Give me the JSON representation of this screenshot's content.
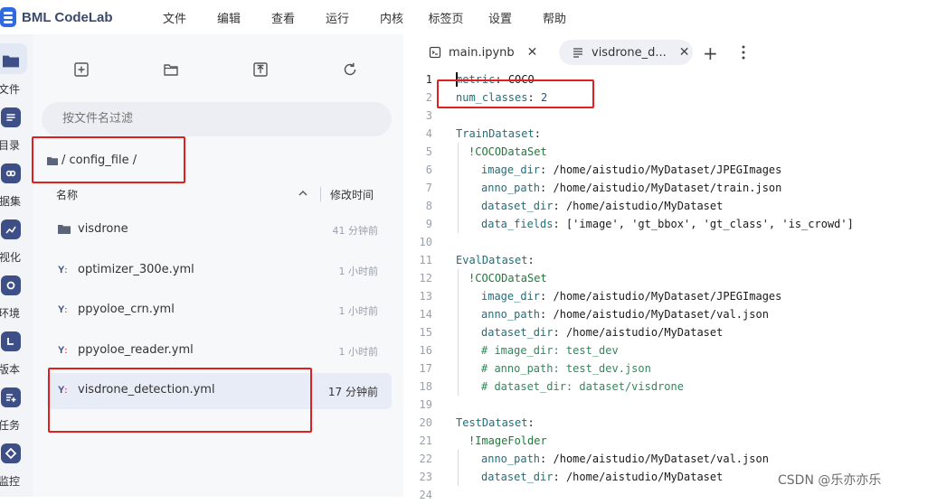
{
  "app": {
    "name": "BML CodeLab",
    "menu": [
      "文件",
      "编辑",
      "查看",
      "运行",
      "内核",
      "标签页",
      "设置",
      "帮助"
    ]
  },
  "rail": [
    {
      "label": "文件",
      "icon": "folder-icon"
    },
    {
      "label": "目录",
      "icon": "list-icon"
    },
    {
      "label": "数据集",
      "icon": "dataset-link-icon"
    },
    {
      "label": "可视化",
      "icon": "chart-icon"
    },
    {
      "label": "环境",
      "icon": "environment-icon"
    },
    {
      "label": "版本",
      "icon": "version-icon"
    },
    {
      "label": "任务",
      "icon": "task-add-icon"
    },
    {
      "label": "监控",
      "icon": "monitor-icon"
    }
  ],
  "filebrowser": {
    "filter_placeholder": "按文件名过滤",
    "breadcrumb": "/ config_file /",
    "col_name": "名称",
    "col_time": "修改时间",
    "files": [
      {
        "name": "visdrone",
        "time": "41 分钟前",
        "type": "folder",
        "selected": false
      },
      {
        "name": "optimizer_300e.yml",
        "time": "1 小时前",
        "type": "yaml",
        "selected": false
      },
      {
        "name": "ppyoloe_crn.yml",
        "time": "1 小时前",
        "type": "yaml",
        "selected": false
      },
      {
        "name": "ppyoloe_reader.yml",
        "time": "1 小时前",
        "type": "yaml",
        "selected": false
      },
      {
        "name": "visdrone_detection.yml",
        "time": "17 分钟前",
        "type": "yaml",
        "selected": true
      }
    ]
  },
  "editor": {
    "tabs": [
      {
        "label": "main.ipynb",
        "active": false
      },
      {
        "label": "visdrone_d...",
        "active": true
      }
    ],
    "lines": [
      {
        "n": "1",
        "indent": 0,
        "key": "metric",
        "value": "COCO"
      },
      {
        "n": "2",
        "indent": 0,
        "key": "num_classes",
        "value": "2"
      },
      {
        "n": "3",
        "indent": 0,
        "blank": true
      },
      {
        "n": "4",
        "indent": 0,
        "key": "TrainDataset",
        "value": ""
      },
      {
        "n": "5",
        "indent": 1,
        "tag": "!COCODataSet"
      },
      {
        "n": "6",
        "indent": 2,
        "key": "image_dir",
        "value": "/home/aistudio/MyDataset/JPEGImages"
      },
      {
        "n": "7",
        "indent": 2,
        "key": "anno_path",
        "value": "/home/aistudio/MyDataset/train.json"
      },
      {
        "n": "8",
        "indent": 2,
        "key": "dataset_dir",
        "value": "/home/aistudio/MyDataset"
      },
      {
        "n": "9",
        "indent": 2,
        "key": "data_fields",
        "value": "['image', 'gt_bbox', 'gt_class', 'is_crowd']"
      },
      {
        "n": "10",
        "indent": 0,
        "blank": true
      },
      {
        "n": "11",
        "indent": 0,
        "key": "EvalDataset",
        "value": ""
      },
      {
        "n": "12",
        "indent": 1,
        "tag": "!COCODataSet"
      },
      {
        "n": "13",
        "indent": 2,
        "key": "image_dir",
        "value": "/home/aistudio/MyDataset/JPEGImages"
      },
      {
        "n": "14",
        "indent": 2,
        "key": "anno_path",
        "value": "/home/aistudio/MyDataset/val.json"
      },
      {
        "n": "15",
        "indent": 2,
        "key": "dataset_dir",
        "value": "/home/aistudio/MyDataset"
      },
      {
        "n": "16",
        "indent": 2,
        "comment": "# image_dir: test_dev"
      },
      {
        "n": "17",
        "indent": 2,
        "comment": "# anno_path: test_dev.json"
      },
      {
        "n": "18",
        "indent": 2,
        "comment": "# dataset_dir: dataset/visdrone"
      },
      {
        "n": "19",
        "indent": 0,
        "blank": true
      },
      {
        "n": "20",
        "indent": 0,
        "key": "TestDataset",
        "value": ""
      },
      {
        "n": "21",
        "indent": 1,
        "tag": "!ImageFolder"
      },
      {
        "n": "22",
        "indent": 2,
        "key": "anno_path",
        "value": "/home/aistudio/MyDataset/val.json"
      },
      {
        "n": "23",
        "indent": 2,
        "key": "dataset_dir",
        "value": "/home/aistudio/MyDataset"
      },
      {
        "n": "24",
        "indent": 0,
        "blank": true
      }
    ]
  },
  "watermark": "CSDN @乐亦亦乐",
  "colors": {
    "accent": "#3d4f86",
    "annotation": "#e02020",
    "selected_row": "#e8ecf6"
  }
}
